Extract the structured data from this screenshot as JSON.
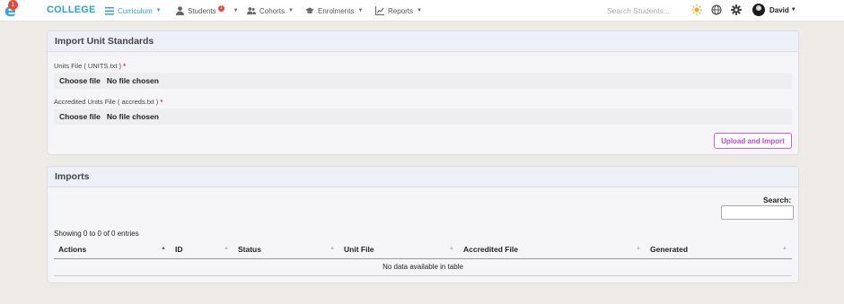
{
  "nav": {
    "logo_badge": "1",
    "brand": "COLLEGE",
    "items": [
      {
        "label": "Curriculum",
        "icon": "list-icon"
      },
      {
        "label": "Students",
        "icon": "user-icon",
        "badge": "1"
      },
      {
        "label": "Cohorts",
        "icon": "users-icon"
      },
      {
        "label": "Enrolments",
        "icon": "graduation-cap-icon"
      },
      {
        "label": "Reports",
        "icon": "chart-line-icon"
      }
    ],
    "search_placeholder": "Search Students...",
    "user_name": "David",
    "colors": {
      "accent": "#2a9fd6",
      "badge": "#e5483a",
      "upload": "#b14dc7"
    }
  },
  "import_card": {
    "title": "Import Unit Standards",
    "units_label": "Units File ( UNITS.txt )",
    "accreds_label": "Accredited Units File ( accreds.txt )",
    "required_mark": "*",
    "choose_label": "Choose file",
    "no_file": "No file chosen",
    "upload_label": "Upload and Import"
  },
  "imports_card": {
    "title": "Imports",
    "search_label": "Search:",
    "info": "Showing 0 to 0 of 0 entries",
    "columns": [
      "Actions",
      "ID",
      "Status",
      "Unit File",
      "Accredited File",
      "Generated"
    ],
    "empty": "No data available in table"
  }
}
